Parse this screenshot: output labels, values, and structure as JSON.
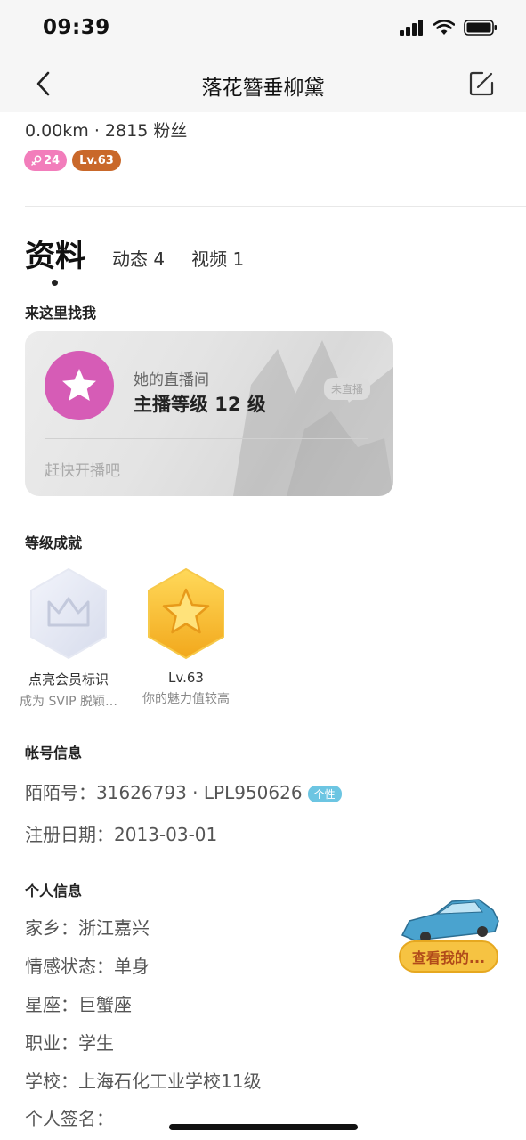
{
  "status_bar": {
    "time": "09:39"
  },
  "nav": {
    "title": "落花簪垂柳黛"
  },
  "profile": {
    "stats": "0.00km · 2815 粉丝",
    "gender_age": "24",
    "level_badge": "Lv.63"
  },
  "tabs": [
    {
      "label": "资料"
    },
    {
      "label": "动态 4"
    },
    {
      "label": "视频 1"
    }
  ],
  "find_me": {
    "section_title": "来这里找我",
    "card_subtitle": "她的直播间",
    "card_title": "主播等级 12 级",
    "status": "未直播",
    "hint": "赶快开播吧"
  },
  "achievements": {
    "section_title": "等级成就",
    "items": [
      {
        "name": "点亮会员标识",
        "desc": "成为 SVIP 脱颖…",
        "icon": "crown-icon"
      },
      {
        "name": "Lv.63",
        "desc": "你的魅力值较高",
        "icon": "star-icon"
      }
    ]
  },
  "account": {
    "section_title": "帐号信息",
    "momo_id": "陌陌号：31626793 · LPL950626",
    "momo_tag": "个性",
    "register_date": "注册日期：2013-03-01"
  },
  "personal": {
    "section_title": "个人信息",
    "hometown": "家乡：浙江嘉兴",
    "relationship": "情感状态：单身",
    "zodiac": "星座：巨蟹座",
    "job": "职业：学生",
    "school": "学校：上海石化工业学校11级",
    "signature": "个人签名："
  },
  "car_widget": {
    "label": "查看我的..."
  },
  "colors": {
    "gender_badge": "#f27dbb",
    "level_badge": "#c9682a",
    "live_avatar": "#d65cb6",
    "tag_blue": "#6cc5e2",
    "car_button": "#f6c342"
  }
}
